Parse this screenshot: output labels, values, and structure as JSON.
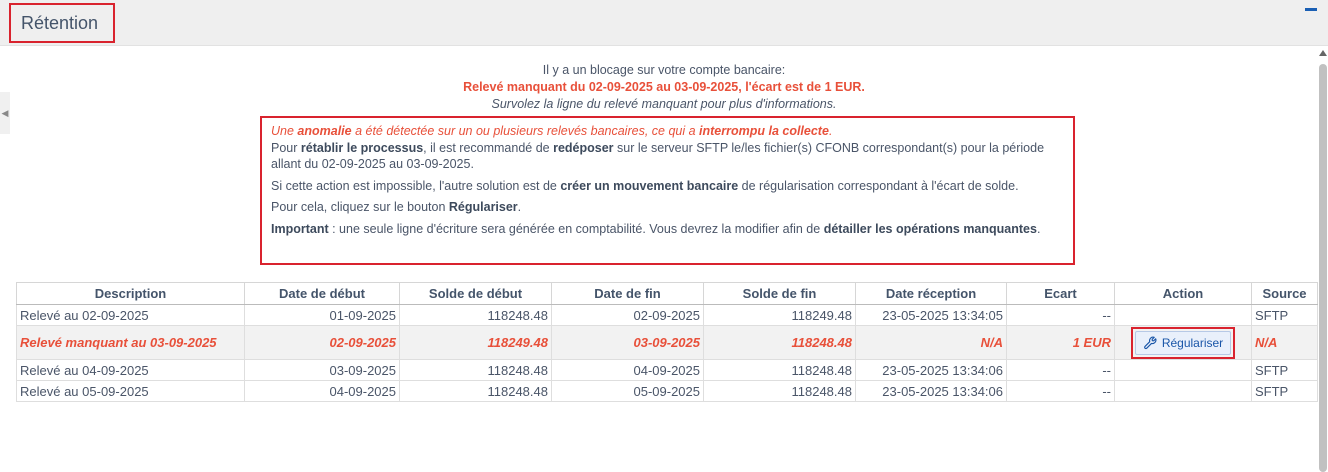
{
  "header": {
    "title": "Rétention"
  },
  "notice": {
    "line1": "Il y a un blocage sur votre compte bancaire:",
    "line2": "Relevé manquant du 02-09-2025 au 03-09-2025, l'écart est de 1 EUR.",
    "line3": "Survolez la ligne du relevé manquant pour plus d'informations."
  },
  "info": {
    "p1_a": "Une ",
    "p1_b": "anomalie",
    "p1_c": " a été détectée sur un ou plusieurs relevés bancaires, ce qui a ",
    "p1_d": "interrompu la collecte",
    "p1_e": ".",
    "p2_a": "Pour ",
    "p2_b": "rétablir le processus",
    "p2_c": ", il est recommandé de ",
    "p2_d": "redéposer",
    "p2_e": " sur le serveur SFTP le/les fichier(s) CFONB correspondant(s) pour la période allant du 02-09-2025 au 03-09-2025.",
    "p3_a": "Si cette action est impossible, l'autre solution est de ",
    "p3_b": "créer un mouvement bancaire",
    "p3_c": " de régularisation correspondant à l'écart de solde.",
    "p4_a": "Pour cela, cliquez sur le bouton ",
    "p4_b": "Régulariser",
    "p4_c": ".",
    "p5_a": "Important",
    "p5_b": " : une seule ligne d'écriture sera générée en comptabilité. Vous devrez la modifier afin de ",
    "p5_c": "détailler les opérations manquantes",
    "p5_d": "."
  },
  "table": {
    "columns": [
      "Description",
      "Date de début",
      "Solde de début",
      "Date de fin",
      "Solde de fin",
      "Date réception",
      "Ecart",
      "Action",
      "Source"
    ],
    "rows": [
      {
        "description": "Relevé au 02-09-2025",
        "date_debut": "01-09-2025",
        "solde_debut": "118248.48",
        "date_fin": "02-09-2025",
        "solde_fin": "118249.48",
        "date_reception": "23-05-2025 13:34:05",
        "ecart": "--",
        "action": "",
        "source": "SFTP"
      },
      {
        "description": "Relevé manquant au 03-09-2025",
        "date_debut": "02-09-2025",
        "solde_debut": "118249.48",
        "date_fin": "03-09-2025",
        "solde_fin": "118248.48",
        "date_reception": "N/A",
        "ecart": "1 EUR",
        "action": "Régulariser",
        "source": "N/A"
      },
      {
        "description": "Relevé au 04-09-2025",
        "date_debut": "03-09-2025",
        "solde_debut": "118248.48",
        "date_fin": "04-09-2025",
        "solde_fin": "118248.48",
        "date_reception": "23-05-2025 13:34:06",
        "ecart": "--",
        "action": "",
        "source": "SFTP"
      },
      {
        "description": "Relevé au 05-09-2025",
        "date_debut": "04-09-2025",
        "solde_debut": "118248.48",
        "date_fin": "05-09-2025",
        "solde_fin": "118248.48",
        "date_reception": "23-05-2025 13:34:06",
        "ecart": "--",
        "action": "",
        "source": "SFTP"
      }
    ]
  },
  "icons": {
    "collapse": "minus-icon",
    "side": "chevron-left-icon",
    "action": "wrench-icon"
  },
  "colors": {
    "alert": "#e8503a",
    "highlight_border": "#d9232e",
    "button_text": "#1a56a8",
    "accent": "#1a5fb4"
  }
}
